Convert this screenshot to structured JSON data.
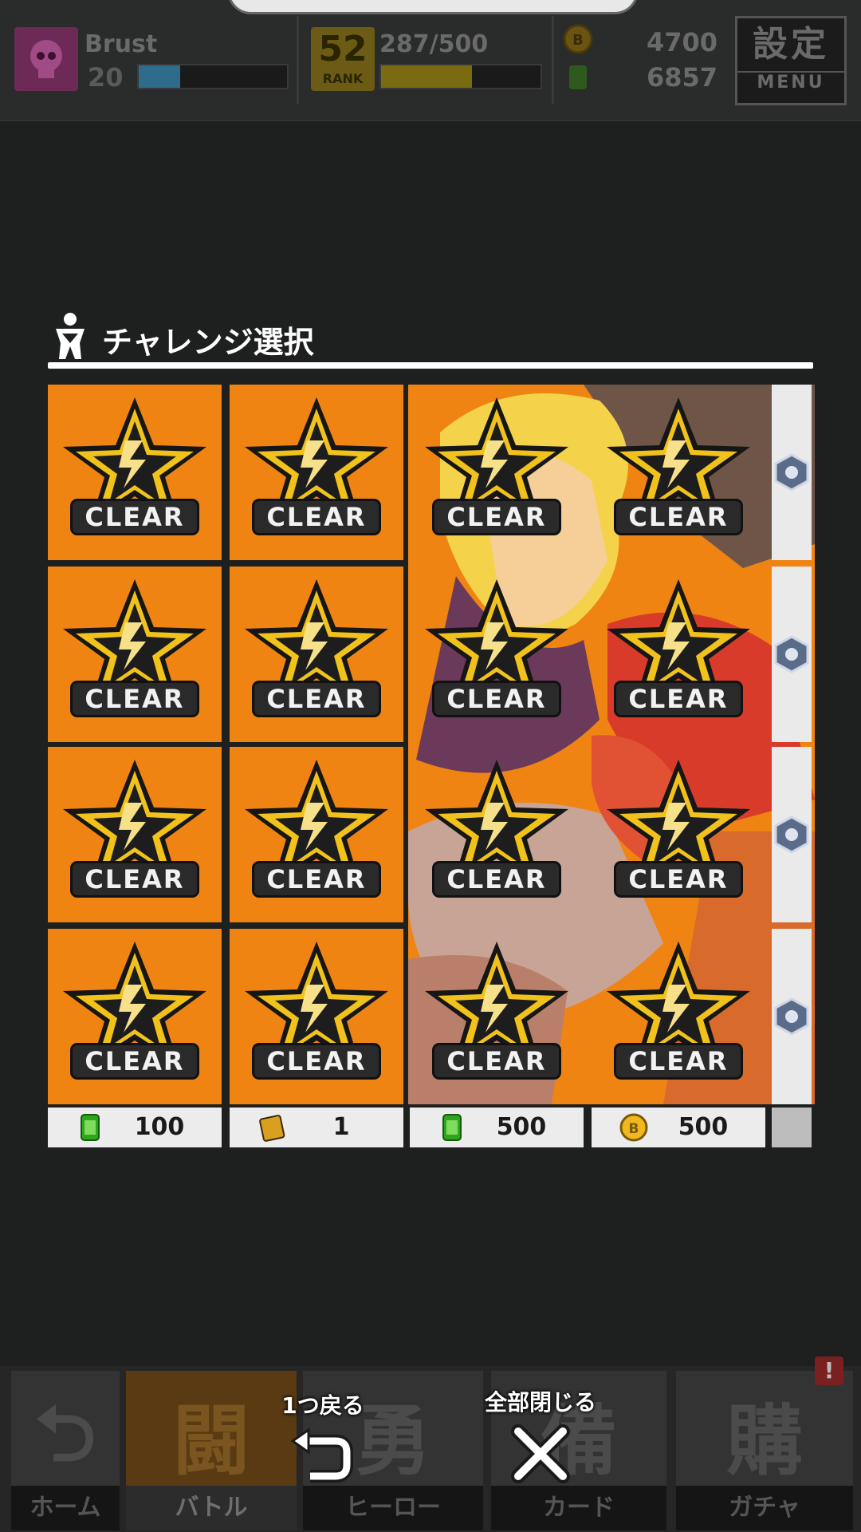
{
  "header": {
    "player_name": "Brust",
    "player_level": "20",
    "xp_fraction": 0.28,
    "rank_number": "52",
    "rank_label": "RANK",
    "stamina": "287/500",
    "stamina_fraction": 0.57,
    "gold_coins": "4700",
    "green_currency": "6857",
    "settings_kanji": "設定",
    "settings_label": "MENU"
  },
  "dialog": {
    "title": "チャレンジ選択",
    "cell_status": "CLEAR",
    "rows": [
      [
        "CLEAR",
        "CLEAR",
        "CLEAR",
        "CLEAR"
      ],
      [
        "CLEAR",
        "CLEAR",
        "CLEAR",
        "CLEAR"
      ],
      [
        "CLEAR",
        "CLEAR",
        "CLEAR",
        "CLEAR"
      ],
      [
        "CLEAR",
        "CLEAR",
        "CLEAR",
        "CLEAR"
      ]
    ],
    "rewards": [
      {
        "icon": "green-canister-icon",
        "value": "100"
      },
      {
        "icon": "card-pack-icon",
        "value": "1"
      },
      {
        "icon": "green-canister-icon",
        "value": "500"
      },
      {
        "icon": "gold-coin-icon",
        "value": "500"
      }
    ]
  },
  "controls": {
    "back_one": "1つ戻る",
    "close_all": "全部閉じる"
  },
  "nav": {
    "tabs": [
      {
        "big": "⮌",
        "label": "ホーム"
      },
      {
        "big": "闘",
        "label": "バトル"
      },
      {
        "big": "勇",
        "label": "ヒーロー"
      },
      {
        "big": "備",
        "label": "カード"
      },
      {
        "big": "購",
        "label": "ガチャ"
      }
    ],
    "alert": "!"
  },
  "colors": {
    "cell_orange": "#ef8413",
    "star_gold": "#f1c21b",
    "background": "#1e1f1f"
  }
}
